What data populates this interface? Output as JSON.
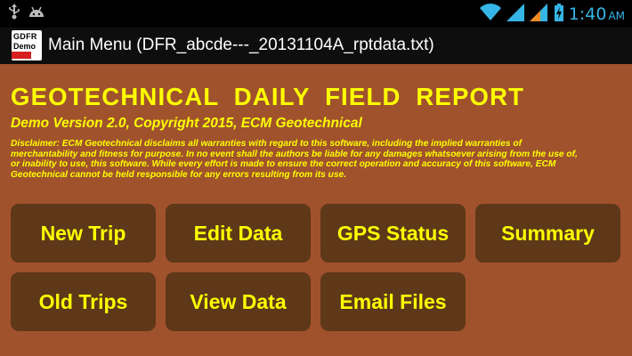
{
  "status_bar": {
    "icons": [
      "usb-icon",
      "android-icon",
      "wifi-icon",
      "signal-icon",
      "signal-icon-2",
      "battery-icon"
    ],
    "time": "1:40",
    "ampm": "AM",
    "accent": "#35b5e5"
  },
  "action_bar": {
    "icon_line1": "GDFR",
    "icon_line2": "Demo",
    "title": "Main Menu (DFR_abcde---_20131104A_rptdata.txt)"
  },
  "main": {
    "title": "GEOTECHNICAL DAILY FIELD REPORT",
    "subtitle": "Demo Version 2.0, Copyright 2015, ECM Geotechnical",
    "disclaimer": "Disclaimer:  ECM Geotechnical disclaims all warranties with regard to this software, including the implied warranties of merchantability and fitness for purpose.  In no event shall the authors be liable for any damages whatsoever arising from the use of, or inability to use, this software.  While every effort is made to ensure the correct operation and accuracy of this software, ECM Geotechnical cannot be held responsible for any errors resulting from its use.",
    "buttons": {
      "new_trip": "New Trip",
      "edit_data": "Edit Data",
      "gps_status": "GPS Status",
      "summary": "Summary",
      "old_trips": "Old Trips",
      "view_data": "View Data",
      "email_files": "Email Files"
    }
  },
  "colors": {
    "background": "#a0522d",
    "button": "#5e3818",
    "text": "#ffff00"
  }
}
